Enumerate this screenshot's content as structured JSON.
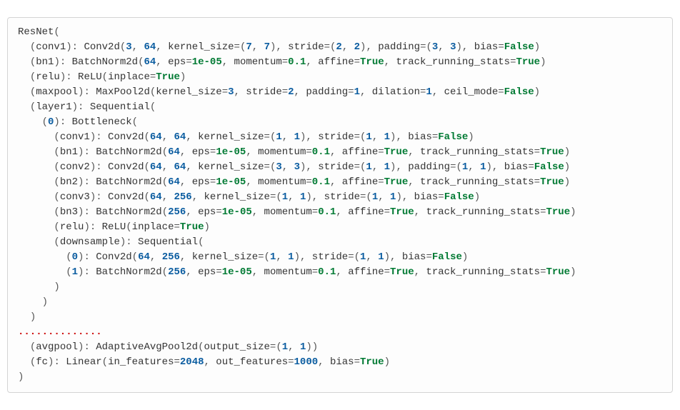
{
  "code_text": "ResNet(\n  (conv1): Conv2d(3, 64, kernel_size=(7, 7), stride=(2, 2), padding=(3, 3), bias=False)\n  (bn1): BatchNorm2d(64, eps=1e-05, momentum=0.1, affine=True, track_running_stats=True)\n  (relu): ReLU(inplace=True)\n  (maxpool): MaxPool2d(kernel_size=3, stride=2, padding=1, dilation=1, ceil_mode=False)\n  (layer1): Sequential(\n    (0): Bottleneck(\n      (conv1): Conv2d(64, 64, kernel_size=(1, 1), stride=(1, 1), bias=False)\n      (bn1): BatchNorm2d(64, eps=1e-05, momentum=0.1, affine=True, track_running_stats=True)\n      (conv2): Conv2d(64, 64, kernel_size=(3, 3), stride=(1, 1), padding=(1, 1), bias=False)\n      (bn2): BatchNorm2d(64, eps=1e-05, momentum=0.1, affine=True, track_running_stats=True)\n      (conv3): Conv2d(64, 256, kernel_size=(1, 1), stride=(1, 1), bias=False)\n      (bn3): BatchNorm2d(256, eps=1e-05, momentum=0.1, affine=True, track_running_stats=True)\n      (relu): ReLU(inplace=True)\n      (downsample): Sequential(\n        (0): Conv2d(64, 256, kernel_size=(1, 1), stride=(1, 1), bias=False)\n        (1): BatchNorm2d(256, eps=1e-05, momentum=0.1, affine=True, track_running_stats=True)\n      )\n    )\n  )\n..............\n  (avgpool): AdaptiveAvgPool2d(output_size=(1, 1))\n  (fc): Linear(in_features=2048, out_features=1000, bias=True)\n)"
}
